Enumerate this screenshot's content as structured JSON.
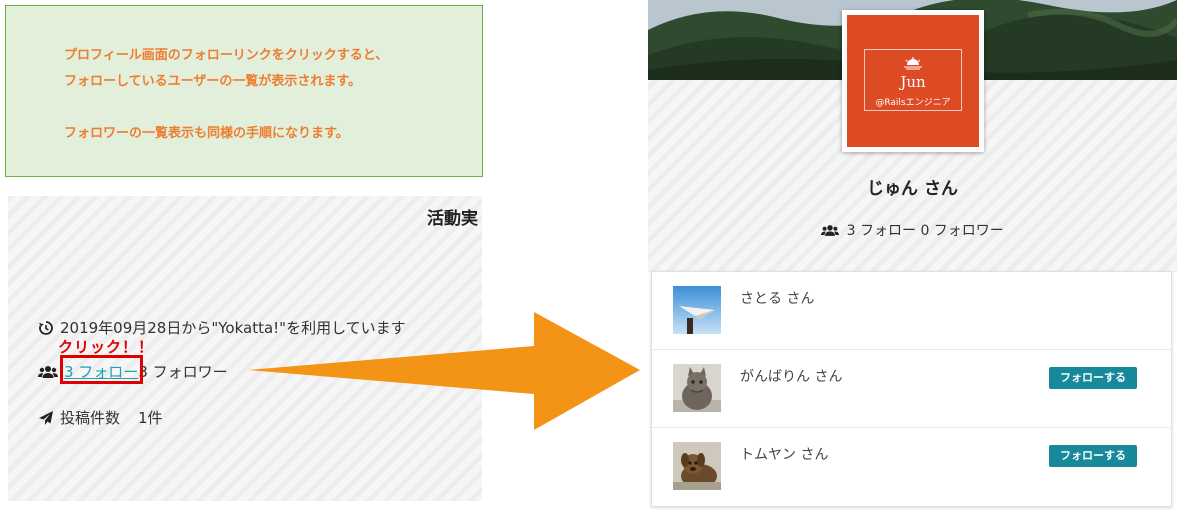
{
  "note": {
    "line1": "プロフィール画面のフォローリンクをクリックすると、",
    "line2": "フォローしているユーザーの一覧が表示されます。",
    "line3": "フォロワーの一覧表示も同様の手順になります。"
  },
  "left_panel": {
    "title": "活動実",
    "since_text": "2019年09月28日から\"Yokatta!\"を利用しています",
    "follow_link": "3 フォロー",
    "followers_text": "3 フォロワー",
    "posts_label": "投稿件数",
    "posts_count": "1件",
    "click_label": "クリック！！"
  },
  "profile": {
    "logo_name": "Jun",
    "logo_handle": "@Railsエンジニア",
    "display_name": "じゅん さん",
    "stats": "3 フォロー 0 フォロワー"
  },
  "follow_list": [
    {
      "name": "さとる さん",
      "avatar": "paper-plane-photo",
      "button": ""
    },
    {
      "name": "がんばりん さん",
      "avatar": "cat-photo",
      "button": "フォローする"
    },
    {
      "name": "トムヤン さん",
      "avatar": "dog-photo",
      "button": "フォローする"
    }
  ],
  "colors": {
    "note_bg": "#e2efda",
    "note_text": "#ed7d31",
    "arrow": "#f39416",
    "highlight": "#e00000",
    "link": "#17a2b8",
    "follow_button": "#17899b",
    "logo_bg": "#dd4b25"
  }
}
